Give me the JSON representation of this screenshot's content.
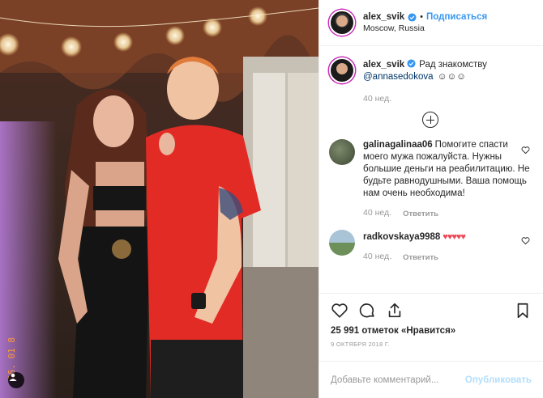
{
  "header": {
    "username": "alex_svik",
    "separator": "•",
    "follow_label": "Подписаться",
    "location": "Moscow, Russia"
  },
  "caption": {
    "username": "alex_svik",
    "text": "Рад знакомству",
    "mention": "@annasedokova",
    "emoji": "☺☺☺",
    "time": "40 нед."
  },
  "comments": [
    {
      "username": "galinagalinaa06",
      "text": "Помогите спасти моего мужа пожалуйста. Нужны большие деньги на реабилитацию. Не будьте равнодушными. Ваша помощь нам очень необходима!",
      "time": "40 нед.",
      "reply_label": "Ответить"
    },
    {
      "username": "radkovskaya9988",
      "text": "♥♥♥♥♥",
      "time": "40 нед.",
      "reply_label": "Ответить"
    }
  ],
  "photo": {
    "timestamp_overlay": "06. 01 8"
  },
  "actions": {
    "likes": "25 991 отметок «Нравится»",
    "date": "9 ОКТЯБРЯ 2018 Г."
  },
  "add_comment": {
    "placeholder": "Добавьте комментарий...",
    "publish_label": "Опубликовать"
  },
  "colors": {
    "link": "#003569",
    "follow": "#3897f0",
    "publish_disabled": "#b2dffc",
    "heart": "#ed4956",
    "border": "#efefef"
  }
}
